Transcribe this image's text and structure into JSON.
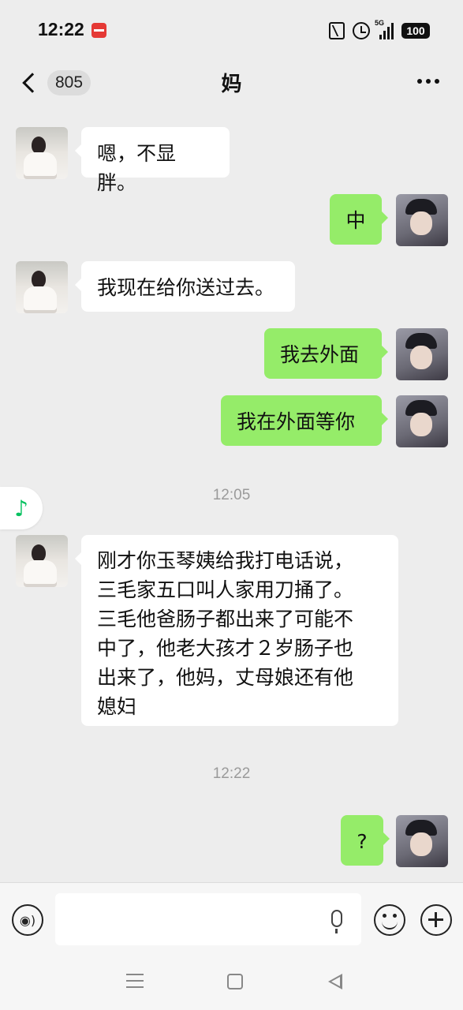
{
  "status_bar": {
    "time": "12:22",
    "network": "5G",
    "battery": "100"
  },
  "header": {
    "unread_count": "805",
    "title": "妈"
  },
  "messages": [
    {
      "from": "contact",
      "text": "嗯，不显胖。"
    },
    {
      "from": "me",
      "text": "中"
    },
    {
      "from": "contact",
      "text": "我现在给你送过去。"
    },
    {
      "from": "me",
      "text": "我去外面"
    },
    {
      "from": "me",
      "text": "我在外面等你"
    },
    {
      "type": "timestamp",
      "text": "12:05"
    },
    {
      "from": "contact",
      "lines": [
        "刚才你玉琴姨给我打电话说，",
        "三毛家五口叫人家用刀捅了。",
        "三毛他爸肠子都出来了可能不",
        "中了，他老大孩才２岁肠子也",
        "出来了，他妈，丈母娘还有他",
        "媳妇"
      ]
    },
    {
      "type": "timestamp",
      "text": "12:22"
    },
    {
      "from": "me",
      "text": "?"
    }
  ],
  "input": {
    "value": "",
    "placeholder": ""
  },
  "colors": {
    "background": "#ededed",
    "outgoing_bubble": "#95ec69",
    "incoming_bubble": "#ffffff",
    "accent": "#07c160"
  },
  "icons": [
    "back-chevron-icon",
    "more-icon",
    "music-note-icon",
    "voice-icon",
    "microphone-icon",
    "emoji-icon",
    "plus-icon",
    "nav-menu-icon",
    "nav-home-icon",
    "nav-back-icon"
  ]
}
